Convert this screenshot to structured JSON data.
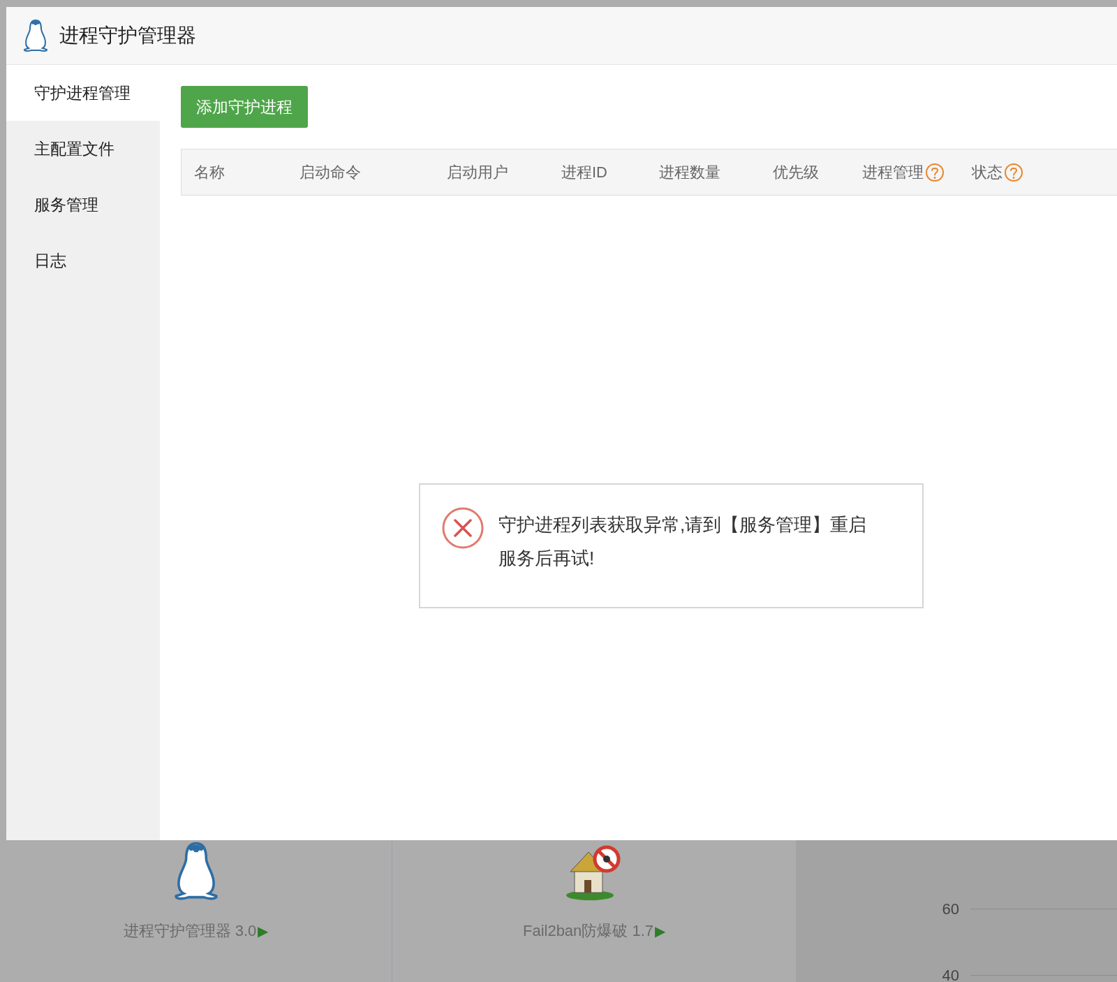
{
  "window": {
    "title": "进程守护管理器"
  },
  "sidebar": {
    "items": [
      {
        "label": "守护进程管理",
        "selected": true
      },
      {
        "label": "主配置文件",
        "selected": false
      },
      {
        "label": "服务管理",
        "selected": false
      },
      {
        "label": "日志",
        "selected": false
      }
    ]
  },
  "toolbar": {
    "add_button": "添加守护进程"
  },
  "table": {
    "columns": [
      {
        "label": "名称",
        "help": false
      },
      {
        "label": "启动命令",
        "help": false
      },
      {
        "label": "启动用户",
        "help": false
      },
      {
        "label": "进程ID",
        "help": false
      },
      {
        "label": "进程数量",
        "help": false
      },
      {
        "label": "优先级",
        "help": false
      },
      {
        "label": "进程管理",
        "help": true
      },
      {
        "label": "状态",
        "help": true
      }
    ]
  },
  "error_message": {
    "text": "守护进程列表获取异常,请到【服务管理】重启服务后再试!"
  },
  "background": {
    "apps": [
      {
        "label": "进程守护管理器 3.0",
        "arrow": "▶",
        "kind": "penguin"
      },
      {
        "label": "Fail2ban防爆破 1.7",
        "arrow": "▶",
        "kind": "house"
      }
    ],
    "chart_ticks": [
      "60",
      "40"
    ]
  }
}
